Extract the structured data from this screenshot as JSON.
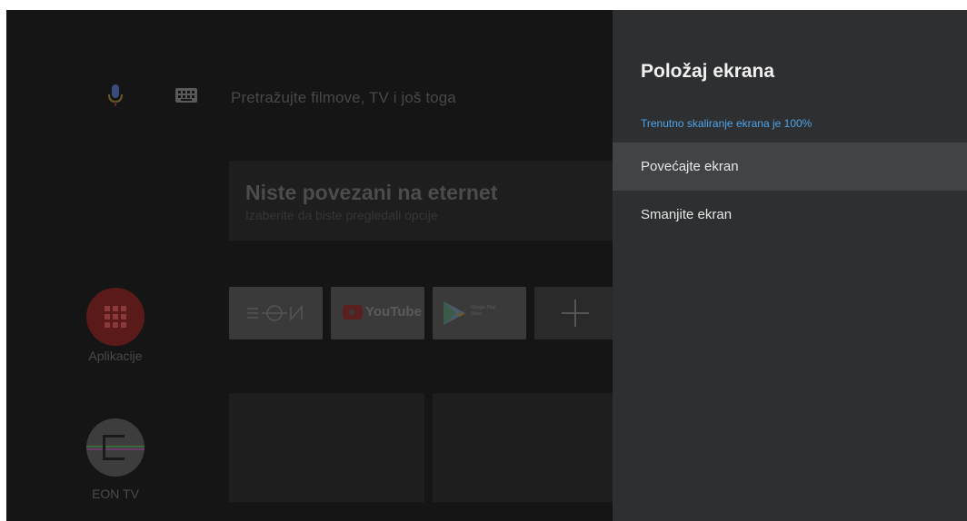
{
  "launcher": {
    "search_hint": "Pretražujte filmove, TV i još toga",
    "banner": {
      "title": "Niste povezani na eternet",
      "subtitle": "Izaberite da biste pregledali opcije"
    },
    "apps_label": "Aplikacije",
    "favorite_apps": [
      {
        "name": "EON",
        "icon": "eon-logo"
      },
      {
        "name": "YouTube",
        "icon": "youtube-logo"
      },
      {
        "name": "Google Play Store",
        "icon": "google-play-logo"
      },
      {
        "name": "Add app",
        "icon": "plus-icon"
      }
    ],
    "youtube_text": "YouTube",
    "play_text_1": "Google Play",
    "play_text_2": "Store",
    "eon_tv_label": "EON TV"
  },
  "panel": {
    "title": "Položaj ekrana",
    "info": "Trenutno skaliranje ekrana je  100%",
    "items": [
      {
        "label": "Povećajte ekran",
        "focused": true
      },
      {
        "label": "Smanjite ekran",
        "focused": false
      }
    ]
  },
  "colors": {
    "panel_bg": "#2d2f31",
    "focused_item_bg": "#414346",
    "info_text": "#4fa3e8",
    "launcher_bg": "#151515"
  }
}
